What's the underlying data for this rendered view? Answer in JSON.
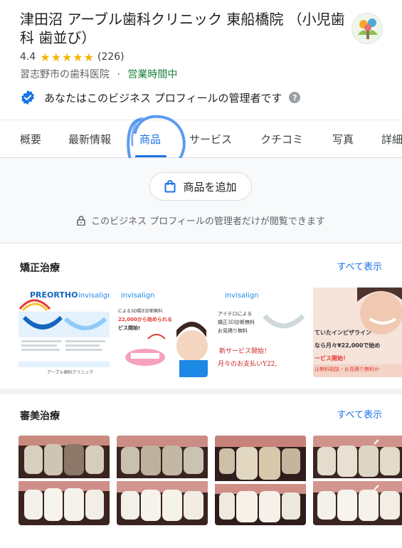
{
  "business": {
    "title": "津田沼 アーブル歯科クリニック 東船橋院 （小児歯科 歯並び）",
    "rating": "4.4",
    "stars": "★★★★★",
    "review_count": "(226)",
    "category": "習志野市の歯科医院",
    "separator": "·",
    "open_status": "営業時間中",
    "owner_message": "あなたはこのビジネス プロフィールの管理者です",
    "help_glyph": "?"
  },
  "tabs": [
    {
      "label": "概要"
    },
    {
      "label": "最新情報"
    },
    {
      "label": "商品"
    },
    {
      "label": "サービス"
    },
    {
      "label": "クチコミ"
    },
    {
      "label": "写真"
    },
    {
      "label": "詳細"
    }
  ],
  "products": {
    "add_button_label": "商品を追加",
    "owner_only_note": "このビジネス プロフィールの管理者だけが閲覧できます"
  },
  "sections": [
    {
      "title": "矯正治療",
      "see_all": "すべて表示",
      "thumbs": [
        {
          "logo_a": "PREORTHO",
          "logo_b": "invisalign",
          "sub": "アーブル歯科クリニック"
        },
        {
          "logo": "invisalign",
          "line1": "による3D矯正診断無料",
          "line2": "22,000から始められる",
          "line3": "ビス開始!"
        },
        {
          "logo": "invisalign",
          "line1": "アイテロによる",
          "line2": "矯正3D診断無料",
          "line3": "お見積り無料",
          "line4": "新サービス開始！",
          "line5": "月々のお支払いY22,"
        },
        {
          "line1": "ていたインビザライン",
          "line2": "なら月々¥22,000で始め",
          "line3": "ービス開始！",
          "line4": "は無料相談・お見積り無料か"
        }
      ]
    },
    {
      "title": "審美治療",
      "see_all": "すべて表示"
    }
  ],
  "colors": {
    "accent": "#1a73e8",
    "star": "#f4b400",
    "open": "#188038",
    "scribble": "#4a8ff0"
  },
  "icons": {
    "verified": "verified-check-icon",
    "shopping_bag": "shopping-bag-icon",
    "lock": "lock-icon",
    "help": "help-icon"
  }
}
